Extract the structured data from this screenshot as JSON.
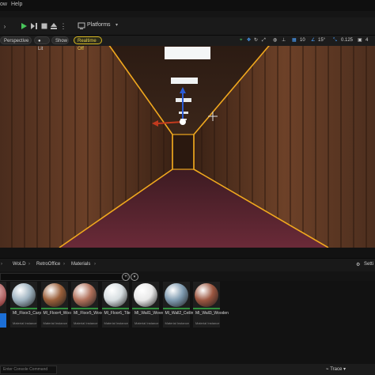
{
  "menu": {
    "help": "Help"
  },
  "toolbar": {
    "platforms": "Platforms"
  },
  "viewport_bar": {
    "perspective": "Perspective",
    "lit": "Lit",
    "show": "Show",
    "realtime": "Realtime Off",
    "grid_snap": "10",
    "rot_snap": "15°",
    "scale_snap": "0.125",
    "cam_speed": "4"
  },
  "breadcrumbs": [
    "WoLD",
    "RetroOffice",
    "Materials"
  ],
  "settings_label": "Setti",
  "assets": [
    {
      "name": "MI_Floor3_Carpet",
      "type": "Material Instance",
      "color": "#9fb3c0"
    },
    {
      "name": "MI_Floor4_WoodFloor",
      "type": "Material Instance",
      "color": "#9a5f3a"
    },
    {
      "name": "MI_Floor5_WoodFloor",
      "type": "Material Instance",
      "color": "#b0705a"
    },
    {
      "name": "MI_Floor6_Tile",
      "type": "Material Instance",
      "color": "#d6dde0"
    },
    {
      "name": "MI_Wall1_Woven",
      "type": "Material Instance",
      "color": "#e8e8e8"
    },
    {
      "name": "MI_Wall2_CeilingTile",
      "type": "Material Instance",
      "color": "#7f9bb0"
    },
    {
      "name": "MI_Wall3_Wooden",
      "type": "Material Instance",
      "color": "#9b5640"
    }
  ],
  "bottom": {
    "console": "Enter Console Command",
    "trace": "Trace"
  }
}
